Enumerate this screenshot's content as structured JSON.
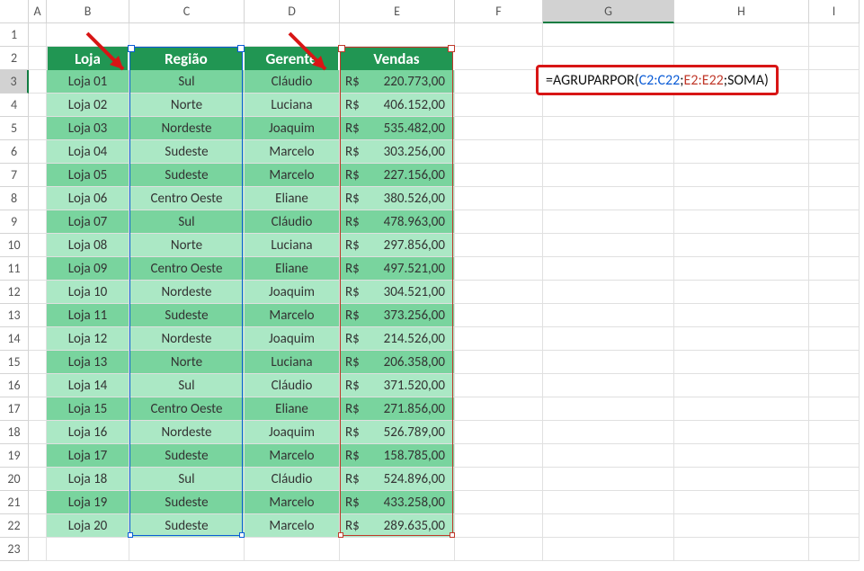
{
  "columns": [
    "A",
    "B",
    "C",
    "D",
    "E",
    "F",
    "G",
    "H",
    "I"
  ],
  "row_count": 23,
  "selected_column": "G",
  "selected_row": 3,
  "headers": {
    "loja": "Loja",
    "regiao": "Região",
    "gerente": "Gerente",
    "vendas": "Vendas"
  },
  "rows": [
    {
      "loja": "Loja 01",
      "regiao": "Sul",
      "gerente": "Cláudio",
      "vendas": "220.773,00"
    },
    {
      "loja": "Loja 02",
      "regiao": "Norte",
      "gerente": "Luciana",
      "vendas": "406.152,00"
    },
    {
      "loja": "Loja 03",
      "regiao": "Nordeste",
      "gerente": "Joaquim",
      "vendas": "535.482,00"
    },
    {
      "loja": "Loja 04",
      "regiao": "Sudeste",
      "gerente": "Marcelo",
      "vendas": "303.256,00"
    },
    {
      "loja": "Loja 05",
      "regiao": "Sudeste",
      "gerente": "Marcelo",
      "vendas": "227.156,00"
    },
    {
      "loja": "Loja 06",
      "regiao": "Centro Oeste",
      "gerente": "Eliane",
      "vendas": "380.526,00"
    },
    {
      "loja": "Loja 07",
      "regiao": "Sul",
      "gerente": "Cláudio",
      "vendas": "478.963,00"
    },
    {
      "loja": "Loja 08",
      "regiao": "Norte",
      "gerente": "Luciana",
      "vendas": "297.856,00"
    },
    {
      "loja": "Loja 09",
      "regiao": "Centro Oeste",
      "gerente": "Eliane",
      "vendas": "497.521,00"
    },
    {
      "loja": "Loja 10",
      "regiao": "Nordeste",
      "gerente": "Joaquim",
      "vendas": "304.521,00"
    },
    {
      "loja": "Loja 11",
      "regiao": "Sudeste",
      "gerente": "Marcelo",
      "vendas": "373.256,00"
    },
    {
      "loja": "Loja 12",
      "regiao": "Nordeste",
      "gerente": "Joaquim",
      "vendas": "214.526,00"
    },
    {
      "loja": "Loja 13",
      "regiao": "Norte",
      "gerente": "Luciana",
      "vendas": "206.358,00"
    },
    {
      "loja": "Loja 14",
      "regiao": "Sul",
      "gerente": "Cláudio",
      "vendas": "371.520,00"
    },
    {
      "loja": "Loja 15",
      "regiao": "Centro Oeste",
      "gerente": "Eliane",
      "vendas": "271.856,00"
    },
    {
      "loja": "Loja 16",
      "regiao": "Nordeste",
      "gerente": "Joaquim",
      "vendas": "526.789,00"
    },
    {
      "loja": "Loja 17",
      "regiao": "Sudeste",
      "gerente": "Marcelo",
      "vendas": "158.785,00"
    },
    {
      "loja": "Loja 18",
      "regiao": "Sul",
      "gerente": "Cláudio",
      "vendas": "524.896,00"
    },
    {
      "loja": "Loja 19",
      "regiao": "Sudeste",
      "gerente": "Marcelo",
      "vendas": "433.258,00"
    },
    {
      "loja": "Loja 20",
      "regiao": "Sudeste",
      "gerente": "Marcelo",
      "vendas": "289.635,00"
    }
  ],
  "currency_symbol": "R$",
  "formula": {
    "eq": "=",
    "fn_open": "AGRUPARPOR(",
    "range1": "C2:C22",
    "sep1": ";",
    "range2": "E2:E22",
    "sep2": ";",
    "arg3": "SOMA",
    "close": ")"
  },
  "selection_ranges": {
    "blue": "C2:C22",
    "red": "E2:E22"
  }
}
